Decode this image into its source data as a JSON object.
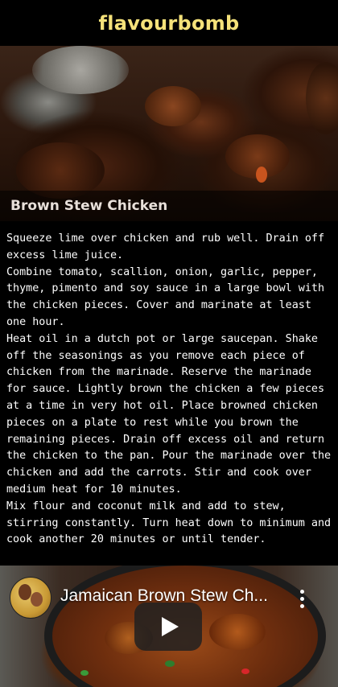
{
  "header": {
    "brand": "flavourbomb"
  },
  "hero": {
    "title": "Brown Stew Chicken",
    "image": "brown-stew-chicken-photo"
  },
  "recipe": {
    "steps": [
      "Squeeze lime over chicken and rub well. Drain off excess lime juice.",
      "Combine tomato, scallion, onion, garlic, pepper, thyme, pimento and soy sauce in a large bowl with the chicken pieces. Cover and marinate at least one hour.",
      "Heat oil in a dutch pot or large saucepan. Shake off the seasonings as you remove each piece of chicken from the marinade. Reserve the marinade for sauce. Lightly brown the chicken a few pieces at a time in very hot oil. Place browned chicken pieces on a plate to rest while you brown the remaining pieces. Drain off excess oil and return the chicken to the pan. Pour the marinade over the chicken and add the carrots. Stir and cook over medium heat for 10 minutes.",
      "Mix flour and coconut milk and add to stew, stirring constantly. Turn heat down to minimum and cook another 20 minutes or until tender."
    ]
  },
  "video": {
    "title": "Jamaican Brown Stew Ch...",
    "icons": {
      "channel": "channel-avatar-icon",
      "menu": "more-vert-icon",
      "play": "play-icon"
    }
  },
  "colors": {
    "brand": "#f5e27a",
    "background": "#000000",
    "text": "#ffffff"
  }
}
